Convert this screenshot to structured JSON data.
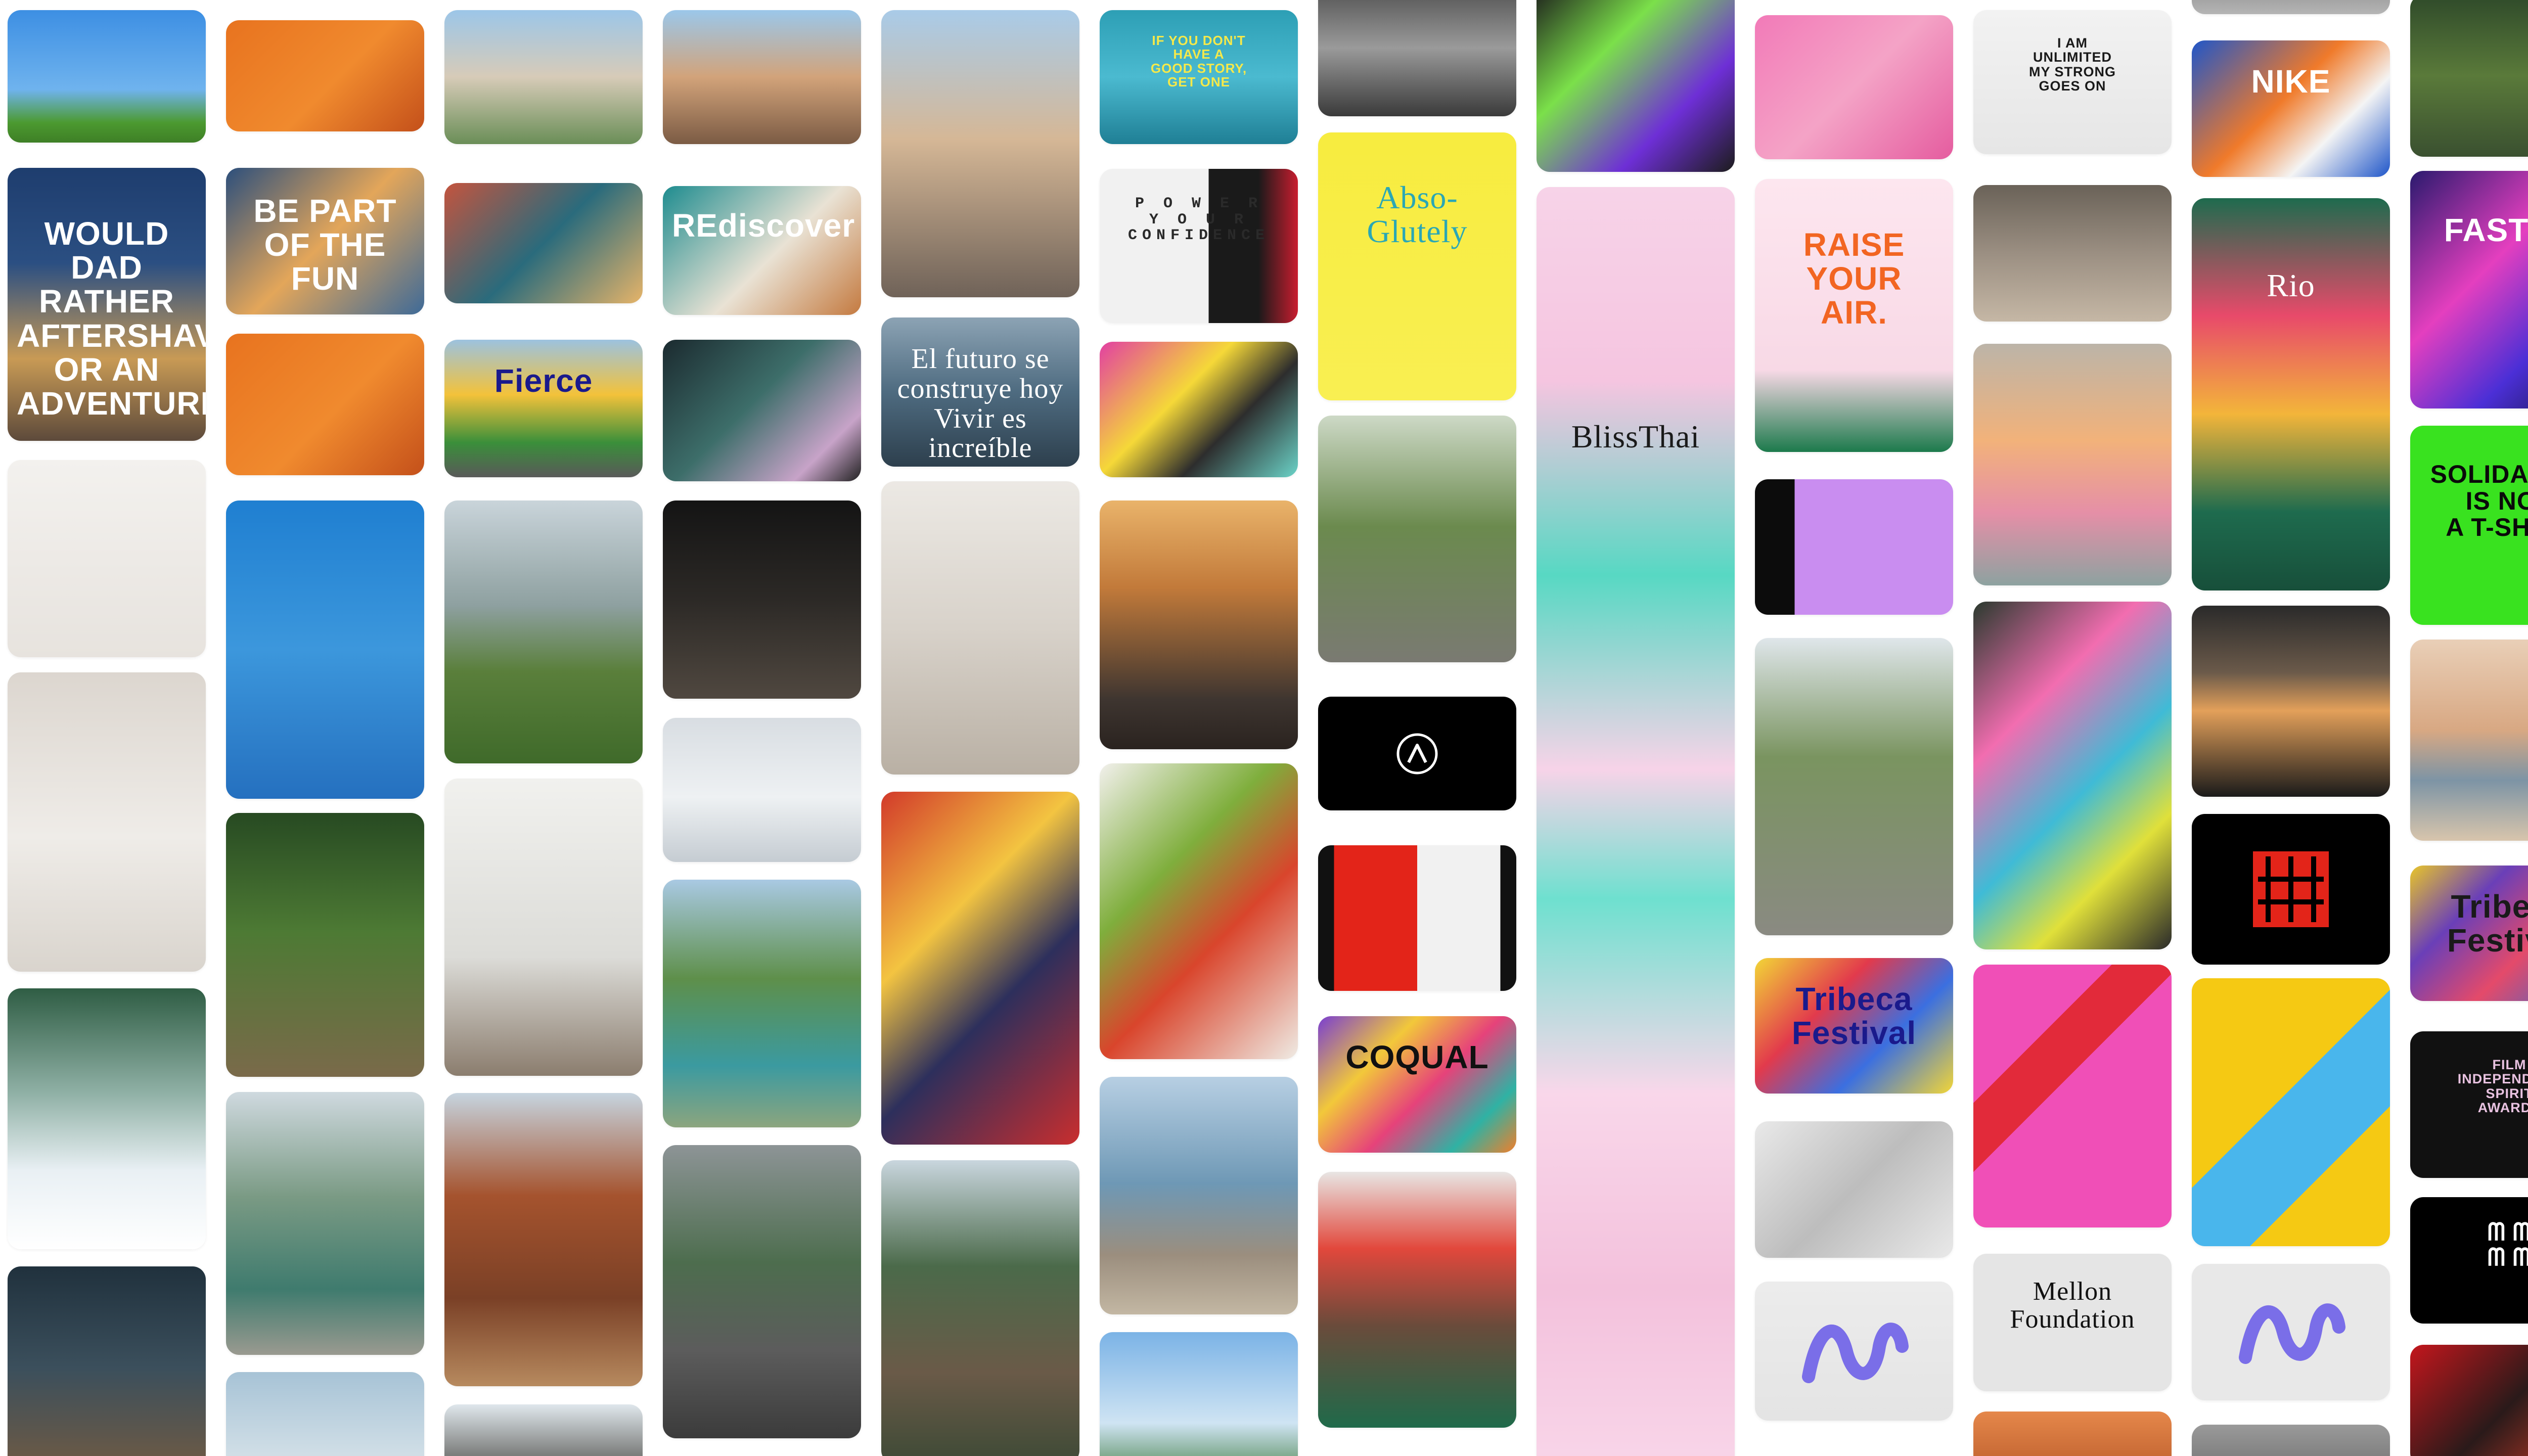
{
  "page": {
    "background": "#ffffff"
  },
  "columns": [
    {
      "tiles": [
        {
          "name": "photo-handstand-field",
          "bg": "linear-gradient(180deg,#3d8fe3 0%,#6fb3ee 60%,#4c9a30 85%,#3e7f26 100%)"
        },
        {
          "name": "ad-would-dad",
          "bg": "linear-gradient(180deg,#1e3d6e 0%,#2b4f82 35%,#c89a55 70%,#5d4a3b 100%)",
          "text": "WOULD DAD\nRATHER AFTERSHAVE\nOR AN ADVENTURE?",
          "color": "#ffffff"
        },
        {
          "name": "photo-pillow-fight",
          "bg": "linear-gradient(180deg,#f3f1ee 0%,#e7e3de 100%)"
        },
        {
          "name": "photo-robe-bed",
          "bg": "linear-gradient(180deg,#dcd6cf 0%,#efece8 55%,#d9d4cd 100%)"
        },
        {
          "name": "photo-ski-snow",
          "bg": "linear-gradient(180deg,#2f5d44 0%,#8fb0a5 40%,#e9f0f4 70%,#ffffff 100%)"
        },
        {
          "name": "photo-car-interior",
          "bg": "linear-gradient(180deg,#20313d 0%,#3b4f5c 50%,#6e5a44 100%)"
        }
      ]
    },
    {
      "tiles": [
        {
          "name": "photo-pink-cap",
          "bg": "linear-gradient(135deg,#e8731f 0%,#f08a2e 55%,#c4501a 100%)"
        },
        {
          "name": "grid-be-part-of-the-fun",
          "bg": "linear-gradient(135deg,#2c4f7c 0%,#e3a65a 50%,#3e6a98 100%)",
          "text": "BE PART OF THE FUN",
          "color": "#ffffff"
        },
        {
          "name": "photo-pink-cap-2",
          "bg": "linear-gradient(135deg,#e8731f 0%,#f08a2e 55%,#c4501a 100%)"
        },
        {
          "name": "photo-underwater-dive",
          "bg": "linear-gradient(180deg,#1f7fd1 0%,#3c97dc 50%,#2570bf 100%)"
        },
        {
          "name": "photo-forest-run",
          "bg": "linear-gradient(180deg,#274a22 0%,#4d7a34 45%,#7a6a4a 100%)"
        },
        {
          "name": "photo-mountain-lake",
          "bg": "linear-gradient(180deg,#cfd9df 0%,#7a9a84 40%,#3f7b6e 75%,#9a9a90 100%)"
        },
        {
          "name": "photo-beach-bottom",
          "bg": "linear-gradient(180deg,#a7c3d6 0%,#d9e4ea 100%)"
        }
      ]
    },
    {
      "tiles": [
        {
          "name": "photo-festival-crowd",
          "bg": "linear-gradient(180deg,#9cc6e8 0%,#d7cbb8 50%,#6a8e57 100%)"
        },
        {
          "name": "grid-bucket-list",
          "bg": "linear-gradient(135deg,#c4543e 0%,#2a6b7c 50%,#e6b469 100%)"
        },
        {
          "name": "photo-fierce-billboard",
          "bg": "linear-gradient(180deg,#9cc2df 0%,#f3c23a 40%,#3a8f3a 75%,#595959 100%)",
          "text": "Fierce",
          "color": "#1a1a8c"
        },
        {
          "name": "photo-golf-field",
          "bg": "linear-gradient(180deg,#c9d4da 0%,#8ea0a0 40%,#5a7f3b 65%,#3f6a2a 100%)"
        },
        {
          "name": "photo-ballet-studio",
          "bg": "linear-gradient(180deg,#f1f1ee 0%,#dcdcd8 60%,#8b7d6e 100%)"
        },
        {
          "name": "photo-canyon-rocks",
          "bg": "linear-gradient(180deg,#c6d4df 0%,#a5532e 35%,#7a4026 70%,#b78a5f 100%)"
        },
        {
          "name": "photo-rock-bottom",
          "bg": "linear-gradient(180deg,#dfe7ec 0%,#4c4a45 100%)"
        }
      ]
    },
    {
      "tiles": [
        {
          "name": "photo-friends-eating",
          "bg": "linear-gradient(180deg,#9bc7ea 0%,#d2a37a 50%,#7b5b44 100%)"
        },
        {
          "name": "ad-rediscover",
          "bg": "linear-gradient(135deg,#1e8c8f 0%,#e9e2d4 55%,#c47a40 100%)",
          "text": "REdiscover",
          "color": "#ffffff"
        },
        {
          "name": "photo-bus-stop-ads",
          "bg": "linear-gradient(135deg,#1b2a2f 0%,#3d6e6a 45%,#c7a3c8 80%,#222 100%)"
        },
        {
          "name": "photo-couch-laughing",
          "bg": "linear-gradient(180deg,#141414 0%,#2c2926 50%,#504840 100%)"
        },
        {
          "name": "photo-bed-sheets",
          "bg": "linear-gradient(180deg,#d8dde2 0%,#eef1f3 55%,#c5ccd2 100%)"
        },
        {
          "name": "photo-alpine-lake",
          "bg": "linear-gradient(180deg,#a9c9e3 0%,#5e8f4a 40%,#3b9aa0 75%,#8ca57e 100%)"
        },
        {
          "name": "photo-palm-road",
          "bg": "linear-gradient(180deg,#8d9496 0%,#4d6d4e 40%,#5c5c5c 70%,#3b3b3b 100%)"
        }
      ]
    },
    {
      "tiles": [
        {
          "name": "photo-hotdog-friends",
          "bg": "linear-gradient(180deg,#a9cbe8 0%,#d5b796 45%,#6f6258 100%)"
        },
        {
          "name": "ad-gnp-futuro",
          "bg": "linear-gradient(180deg,#8ca3b4 0%,#4e6b80 50%,#2d3f4d 100%)",
          "text": "El futuro se construye hoy\nVivir es increíble",
          "color": "#ffffff",
          "serif": true
        },
        {
          "name": "photo-pillow-hug",
          "bg": "linear-gradient(180deg,#ece9e4 0%,#d8d2ca 50%,#b9b0a4 100%)"
        },
        {
          "name": "photo-fruit-tray",
          "bg": "linear-gradient(135deg,#d23a2a 0%,#f3c441 35%,#2d2f5c 60%,#c92e2e 100%)"
        },
        {
          "name": "photo-hikers-forest",
          "bg": "linear-gradient(180deg,#c9d6de 0%,#4b6a4a 35%,#6a5a48 70%,#3e4a36 100%)"
        }
      ]
    },
    {
      "tiles": [
        {
          "name": "ad-good-story",
          "bg": "linear-gradient(180deg,#2d9fb5 0%,#4bbad0 50%,#1f7f95 100%)",
          "text": "IF YOU DON'T\nHAVE A\nGOOD STORY,\nGET ONE",
          "color": "#f5e94a"
        },
        {
          "name": "ad-power-confidence",
          "bg": "linear-gradient(90deg,#f1f1f1 0%,#f1f1f1 55%,#1a1a1a 55%,#1a1a1a 80%,#c81d2f 100%)",
          "text": "P O W E R\nY O U R\nCONFIDENCE",
          "color": "#2a2a2a",
          "mono": true
        },
        {
          "name": "art-graffiti-legs",
          "bg": "linear-gradient(135deg,#e23fa2 0%,#f5d838 40%,#2d2d2d 65%,#6bd3c8 100%)"
        },
        {
          "name": "photo-sunset-swing",
          "bg": "linear-gradient(180deg,#e9b36a 0%,#c27a3a 35%,#3e3530 80%,#2a231f 100%)"
        },
        {
          "name": "photo-vegetables",
          "bg": "linear-gradient(135deg,#f2f0ec 0%,#7fae3c 35%,#d9452c 60%,#efebe4 100%)"
        },
        {
          "name": "photo-beach-runners",
          "bg": "linear-gradient(180deg,#b7cfe3 0%,#6e98b5 45%,#9b8e7e 75%,#c3b7a3 100%)"
        },
        {
          "name": "photo-palm-sky",
          "bg": "linear-gradient(180deg,#7bb3e6 0%,#cfe4f3 60%,#3e7a3a 100%)"
        }
      ]
    },
    {
      "tiles": [
        {
          "name": "photo-motion-bw",
          "bg": "linear-gradient(180deg,#4a4a4a 0%,#9a9a9a 50%,#3a3a3a 100%)"
        },
        {
          "name": "ad-abso-glutely",
          "bg": "linear-gradient(180deg,#f7ec3f 0%,#f9ef52 100%)",
          "text": "Abso-\nGlutely",
          "color": "#2aa7b5",
          "serif": true
        },
        {
          "name": "photo-bike-arms-up",
          "bg": "linear-gradient(180deg,#cdd9c6 0%,#6b8a4e 45%,#7a7a72 100%)"
        },
        {
          "name": "logo-tile-black",
          "bg": "#000000",
          "icon": "caret-circle-icon"
        },
        {
          "name": "book-red-spread",
          "bg": "linear-gradient(90deg,#111 0%,#111 8%,#e32419 8%,#e32419 50%,#f1f1f1 50%,#f1f1f1 92%,#111 92%)"
        },
        {
          "name": "poster-coqual",
          "bg": "linear-gradient(135deg,#7a3fd1 0%,#f2c83a 30%,#e6427a 55%,#2fb2a4 80%,#f07f2a 100%)",
          "text": "COQUAL",
          "color": "#111111"
        },
        {
          "name": "photo-portrait-grandma",
          "bg": "linear-gradient(180deg,#e8e6e4 0%,#e2483c 30%,#6a4b3b 60%,#1f6a4a 100%)"
        }
      ]
    },
    {
      "tiles": [
        {
          "name": "art-neon-dancer",
          "bg": "linear-gradient(135deg,#1c1c1c 0%,#7be04a 35%,#6e2fd6 70%,#1c1c1c 100%)"
        },
        {
          "name": "brand-bliss-thai",
          "bg": "linear-gradient(180deg,#f7d3e8 0%,#f5c5e0 15%,#57d8c3 30%,#f7d3e8 45%,#6ee0cf 55%,#f9d7ea 70%,#f3c1dc 85%,#f9d7ea 100%)",
          "text": "BlissThai",
          "color": "#1a1a1a",
          "serif": true
        }
      ]
    },
    {
      "tiles": [
        {
          "name": "art-pink-ribbon",
          "bg": "linear-gradient(135deg,#f27ab8 0%,#f4a3c6 50%,#e55c9f 100%)"
        },
        {
          "name": "ad-raise-your-air",
          "bg": "linear-gradient(180deg,#fde6ef 0%,#f8d9e6 70%,#1c7a4c 100%)",
          "text": "RAISE\nYOUR\nAIR.",
          "color": "#f26522"
        },
        {
          "name": "screen-purple-site",
          "bg": "linear-gradient(90deg,#0c0c0c 0%,#0c0c0c 20%,#c98df0 20%,#c98df0 100%)"
        },
        {
          "name": "photo-skate-path",
          "bg": "linear-gradient(180deg,#dfe6ea 0%,#7a9460 40%,#8a8a82 100%)"
        },
        {
          "name": "poster-tribeca-festival",
          "bg": "linear-gradient(135deg,#f2d637 0%,#e23a4c 35%,#3b6fe0 65%,#f2d637 100%)",
          "text": "Tribeca Festival",
          "color": "#1a1a8c"
        },
        {
          "name": "grid-photo-collage",
          "bg": "linear-gradient(135deg,#e9e9e9 0%,#bdbdbd 50%,#e9e9e9 100%)"
        },
        {
          "name": "art-blue-squiggle",
          "bg": "linear-gradient(180deg,#ececec 0%,#e4e4e4 100%)",
          "icon": "squiggle-icon"
        }
      ]
    },
    {
      "tiles": [
        {
          "name": "ad-unlimited-strong",
          "bg": "linear-gradient(180deg,#f2f2f2 0%,#e6e6e6 100%)",
          "text": "I AM\nUNLIMITED\nMY STRONG\nGOES ON",
          "color": "#1a1a1a"
        },
        {
          "name": "photo-skater-jump",
          "bg": "linear-gradient(180deg,#6a6258 0%,#9b8f82 50%,#c5b7a5 100%)"
        },
        {
          "name": "photo-slides-park",
          "bg": "linear-gradient(180deg,#bcb4a8 0%,#f2b27a 40%,#e58fa7 70%,#8da2a0 100%)"
        },
        {
          "name": "photo-swing-feet",
          "bg": "linear-gradient(135deg,#2a3a2e 0%,#f26db0 30%,#3fbbd6 55%,#e0e03a 75%,#2a2a2a 100%)"
        },
        {
          "name": "art-letter-k",
          "bg": "linear-gradient(135deg,#f04fb7 0%,#f04fb7 30%,#e22a3a 30%,#e22a3a 45%,#f04fb7 45%,#f04fb7 100%)"
        },
        {
          "name": "logo-mellon-foundation",
          "bg": "#e5e5e5",
          "text": "Mellon\nFoundation",
          "color": "#111111",
          "serif": true
        },
        {
          "name": "photo-bottom-orange",
          "bg": "linear-gradient(180deg,#e5874a 0%,#b85a2a 100%)"
        }
      ]
    },
    {
      "tiles": [
        {
          "name": "photo-grey-top",
          "bg": "linear-gradient(180deg,#8c8c8c 0%,#b5b5b5 100%)"
        },
        {
          "name": "ad-nike-stop",
          "bg": "linear-gradient(135deg,#1f56c9 0%,#f07a2a 45%,#f4f4f4 70%,#1f56c9 100%)",
          "text": "NIKE",
          "color": "#ffffff"
        },
        {
          "name": "poster-rio-carnival",
          "bg": "linear-gradient(180deg,#1e6b4e 0%,#e84a6a 30%,#f3b53a 55%,#1e6b4e 80%,#174f3a 100%)",
          "text": "Rio",
          "color": "#ffffff",
          "serif": true
        },
        {
          "name": "photo-car-roof-sunset",
          "bg": "linear-gradient(180deg,#2a2a2a 0%,#6b5a4a 35%,#e3a05a 55%,#1a1a1a 100%)"
        },
        {
          "name": "logo-red-grid",
          "bg": "#000000",
          "icon": "red-grid-icon"
        },
        {
          "name": "art-yellow-blue-shape",
          "bg": "linear-gradient(135deg,#f5c913 0%,#f5c913 45%,#49b6ec 45%,#49b6ec 70%,#f5c913 70%)"
        },
        {
          "name": "art-squiggle-multicolor",
          "bg": "#e8e8e8",
          "icon": "squiggle-icon"
        },
        {
          "name": "photo-bottom-grey",
          "bg": "linear-gradient(180deg,#9a9a9a 0%,#6a6a6a 100%)"
        }
      ]
    },
    {
      "tiles": [
        {
          "name": "photo-forest-edge",
          "bg": "linear-gradient(180deg,#2f4a2a 0%,#5a7a3a 50%,#3a5030 100%)"
        },
        {
          "name": "ad-nike-faster",
          "bg": "linear-gradient(135deg,#2a1a6e 0%,#e43fbf 40%,#4b2fd6 70%,#14123a 100%)",
          "text": "FASTER",
          "color": "#ffffff"
        },
        {
          "name": "poster-solidarity",
          "bg": "#39e21f",
          "text": "SOLIDARITY\nIS NOT\nA T-SHIRT",
          "color": "#0a0a0a"
        },
        {
          "name": "photo-beach-dance",
          "bg": "linear-gradient(180deg,#e9cfb7 0%,#d8a883 45%,#7d94a5 70%,#d8c5ac 100%)"
        },
        {
          "name": "stickers-tribeca",
          "bg": "linear-gradient(135deg,#e8c52a 0%,#6a3fb8 30%,#e44a6a 60%,#2a6ad6 100%)",
          "text": "Tribeca Festival",
          "color": "#1a1a1a"
        },
        {
          "name": "poster-film-awards",
          "bg": "#111111",
          "text": "FILM\nINDEPENDENT\nSPIRIT\nAWARDS",
          "color": "#e8c2e0"
        },
        {
          "name": "logo-mm-squiggle",
          "bg": "#000000",
          "text": "ᗰ ᗰ\nᗰ ᗰ",
          "color": "#ffffff"
        },
        {
          "name": "art-red-chaos",
          "bg": "linear-gradient(135deg,#c4161c 0%,#2a1a1a 50%,#e0402a 100%)"
        }
      ]
    }
  ]
}
